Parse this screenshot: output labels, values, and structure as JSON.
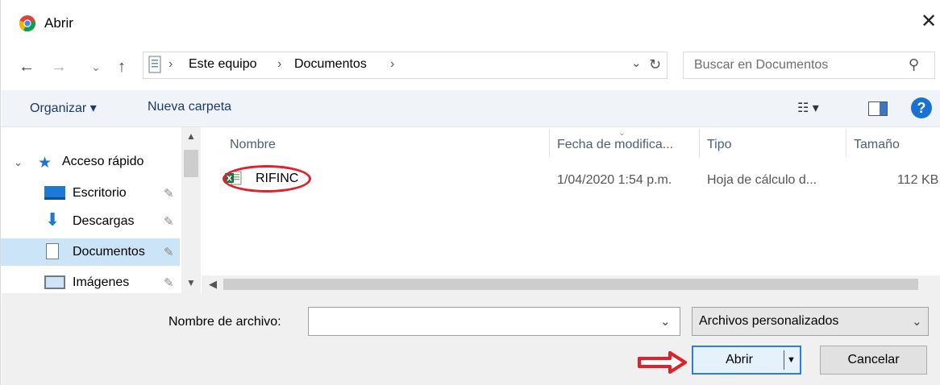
{
  "window": {
    "title": "Abrir",
    "close_glyph": "✕",
    "app_icon": "chrome-icon"
  },
  "nav_buttons": {
    "back": "←",
    "forward": "→",
    "recent": "⌄",
    "up": "↑"
  },
  "address": {
    "crumbs": [
      "Este equipo",
      "Documentos"
    ],
    "separator": "›",
    "dropdown": "⌄",
    "refresh": "↻"
  },
  "search": {
    "placeholder": "Buscar en Documentos",
    "icon": "⚲"
  },
  "toolbar": {
    "organize": "Organizar ▾",
    "new_folder": "Nueva carpeta",
    "view_glyph": "☷ ▾",
    "help": "?"
  },
  "sidebar": {
    "quick_access": "Acceso rápido",
    "items": [
      {
        "label": "Escritorio",
        "pinned": true
      },
      {
        "label": "Descargas",
        "pinned": true
      },
      {
        "label": "Documentos",
        "pinned": true,
        "selected": true
      },
      {
        "label": "Imágenes",
        "pinned": true
      }
    ]
  },
  "columns": [
    "Nombre",
    "Fecha de modifica...",
    "Tipo",
    "Tamaño"
  ],
  "files": [
    {
      "name": "RIFINC",
      "modified": "1/04/2020 1:54 p.m.",
      "type": "Hoja de cálculo d...",
      "size": "112 KB",
      "icon": "excel-file-icon"
    }
  ],
  "bottom": {
    "filename_label": "Nombre de archivo:",
    "filename_value": "",
    "filter_value": "Archivos personalizados",
    "open_label": "Abrir",
    "cancel_label": "Cancelar"
  },
  "colors": {
    "accent": "#2b7fd8",
    "selection": "#cce4f7",
    "annotation": "#e0202a"
  }
}
